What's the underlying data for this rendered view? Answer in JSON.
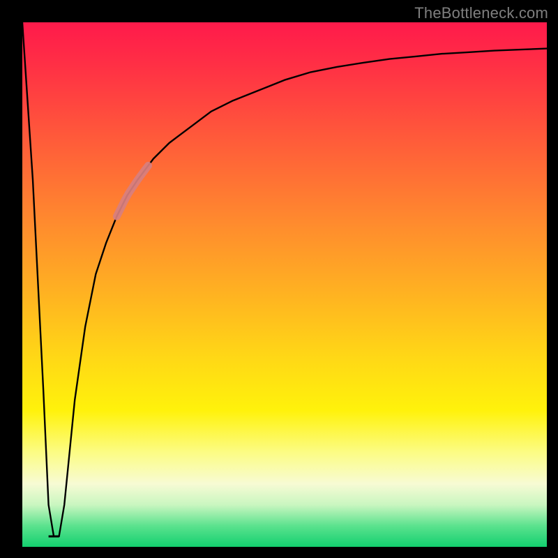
{
  "watermark": "TheBottleneck.com",
  "colors": {
    "frame": "#000000",
    "curve": "#000000",
    "highlight": "#d87f7f",
    "gradient_top": "#ff1a4b",
    "gradient_bottom": "#13d06f"
  },
  "chart_data": {
    "type": "line",
    "title": "",
    "xlabel": "",
    "ylabel": "",
    "xlim": [
      0,
      100
    ],
    "ylim": [
      0,
      100
    ],
    "x": [
      0,
      2,
      4,
      5,
      6,
      7,
      8,
      9,
      10,
      12,
      14,
      16,
      18,
      20,
      22,
      25,
      28,
      32,
      36,
      40,
      45,
      50,
      55,
      60,
      65,
      70,
      75,
      80,
      85,
      90,
      95,
      100
    ],
    "y": [
      100,
      70,
      30,
      8,
      2,
      2,
      8,
      18,
      28,
      42,
      52,
      58,
      63,
      67,
      70,
      74,
      77,
      80,
      83,
      85,
      87,
      89,
      90.5,
      91.5,
      92.3,
      93,
      93.5,
      94,
      94.3,
      94.6,
      94.8,
      95
    ],
    "notch_flat": {
      "x_range": [
        5,
        7
      ],
      "y": 2
    },
    "highlight_segment": {
      "x_range": [
        18,
        24
      ],
      "y_range": [
        61,
        72
      ]
    },
    "annotations": []
  }
}
